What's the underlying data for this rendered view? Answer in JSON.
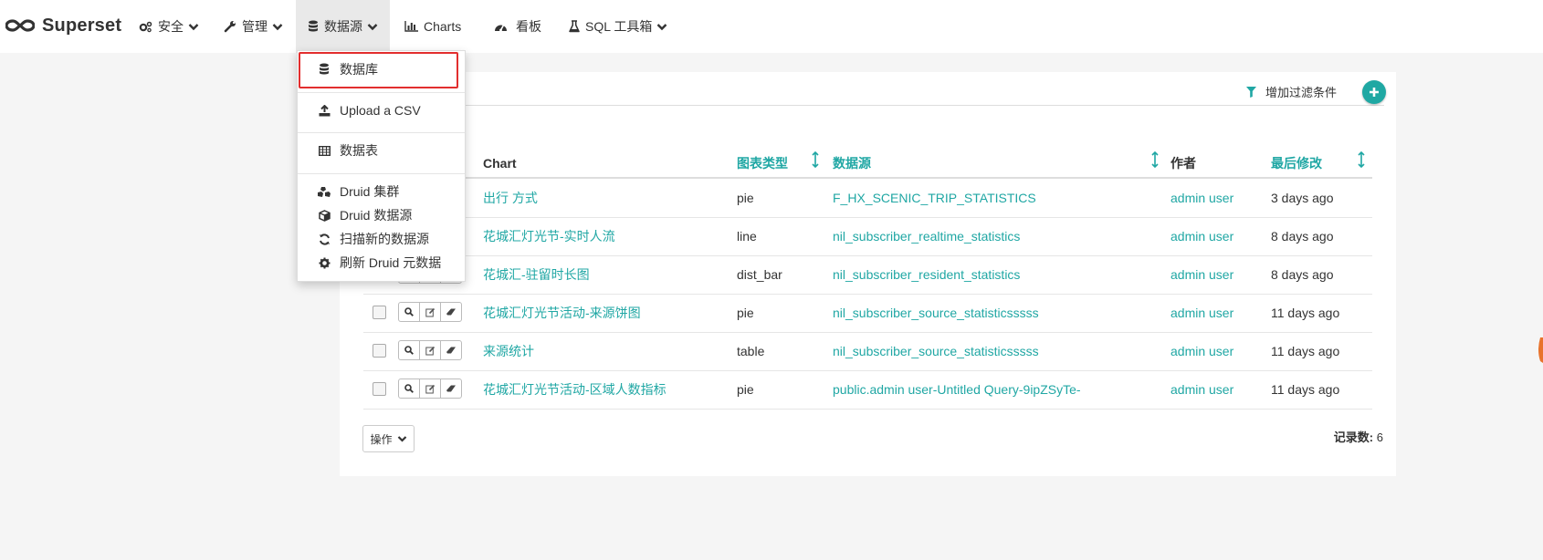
{
  "brand": {
    "name": "Superset"
  },
  "nav": {
    "security": "安全",
    "manage": "管理",
    "sources": "数据源",
    "charts": "Charts",
    "dashboards": "看板",
    "sql_lab": "SQL 工具箱"
  },
  "dropdown": {
    "items": [
      {
        "label": "数据库",
        "icon": "database-icon"
      },
      {
        "label": "Upload a CSV",
        "icon": "upload-icon"
      },
      {
        "label": "数据表",
        "icon": "table-icon"
      },
      {
        "label": "Druid 集群",
        "icon": "cubes-icon"
      },
      {
        "label": "Druid 数据源",
        "icon": "cube-icon"
      },
      {
        "label": "扫描新的数据源",
        "icon": "refresh-icon"
      },
      {
        "label": "刷新 Druid 元数据",
        "icon": "cog-icon"
      }
    ]
  },
  "filter": {
    "add_label": "增加过滤条件"
  },
  "table": {
    "headers": {
      "chart": "Chart",
      "viz_type": "图表类型",
      "datasource": "数据源",
      "creator": "作者",
      "modified": "最后修改"
    },
    "rows": [
      {
        "chart": "出行 方式",
        "viz_type": "pie",
        "datasource": "F_HX_SCENIC_TRIP_STATISTICS",
        "creator": "admin user",
        "modified": "3 days ago"
      },
      {
        "chart": "花城汇灯光节-实时人流",
        "viz_type": "line",
        "datasource": "nil_subscriber_realtime_statistics",
        "creator": "admin user",
        "modified": "8 days ago"
      },
      {
        "chart": "花城汇-驻留时长图",
        "viz_type": "dist_bar",
        "datasource": "nil_subscriber_resident_statistics",
        "creator": "admin user",
        "modified": "8 days ago"
      },
      {
        "chart": "花城汇灯光节活动-来源饼图",
        "viz_type": "pie",
        "datasource": "nil_subscriber_source_statisticsssss",
        "creator": "admin user",
        "modified": "11 days ago"
      },
      {
        "chart": "来源统计",
        "viz_type": "table",
        "datasource": "nil_subscriber_source_statisticsssss",
        "creator": "admin user",
        "modified": "11 days ago"
      },
      {
        "chart": "花城汇灯光节活动-区域人数指标",
        "viz_type": "pie",
        "datasource": "public.admin user-Untitled Query-9ipZSyTe-",
        "creator": "admin user",
        "modified": "11 days ago"
      }
    ]
  },
  "actions": {
    "label": "操作"
  },
  "record_count": {
    "label": "记录数:",
    "value": "6"
  },
  "colors": {
    "accent": "#20a7a4",
    "highlight": "#e22e2e"
  }
}
